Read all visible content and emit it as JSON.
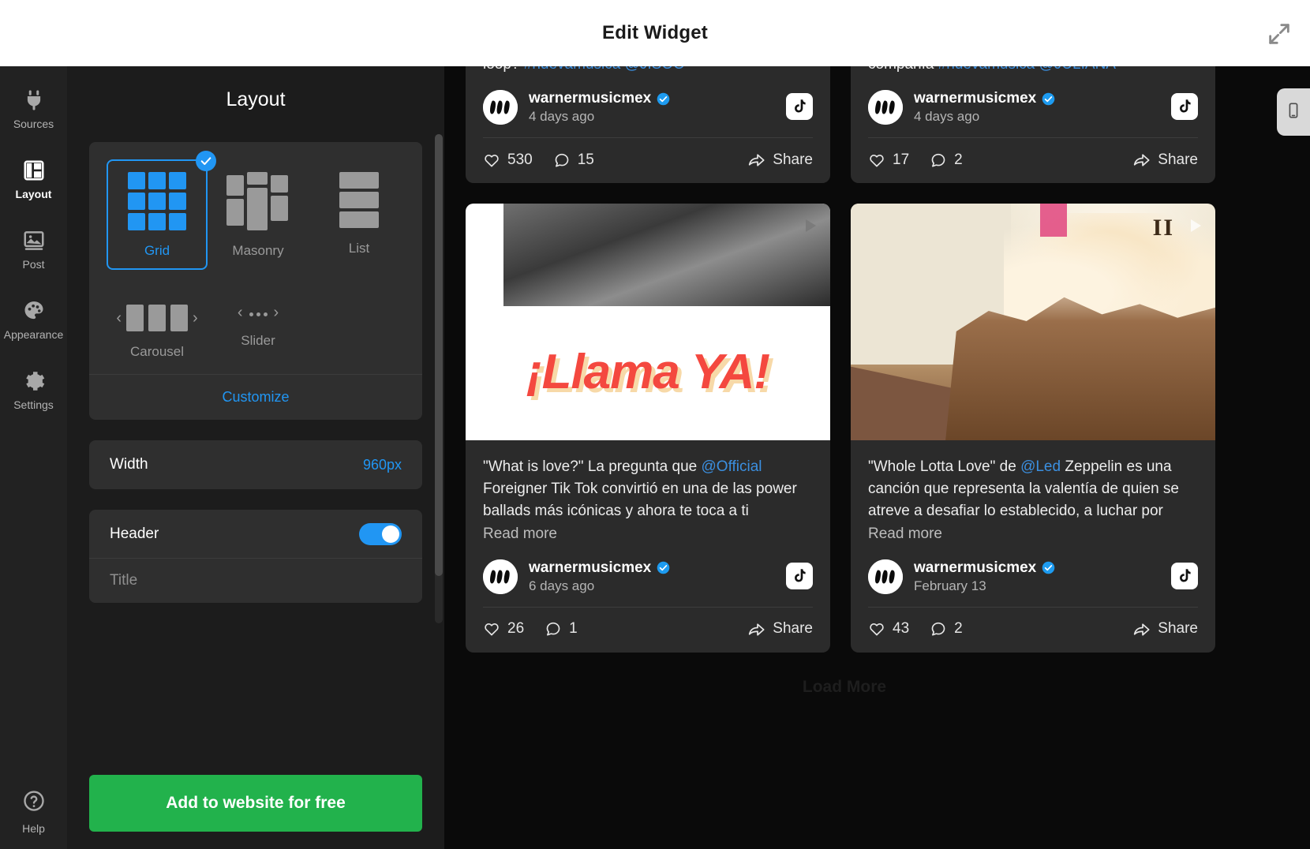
{
  "window": {
    "title": "Edit Widget",
    "expand_icon": "expand-arrows-icon"
  },
  "rail": {
    "items": [
      {
        "label": "Sources",
        "icon": "plug-icon",
        "active": false
      },
      {
        "label": "Layout",
        "icon": "layout-columns-icon",
        "active": true
      },
      {
        "label": "Post",
        "icon": "image-icon",
        "active": false
      },
      {
        "label": "Appearance",
        "icon": "palette-icon",
        "active": false
      },
      {
        "label": "Settings",
        "icon": "gear-icon",
        "active": false
      }
    ],
    "help": {
      "label": "Help",
      "icon": "question-circle-icon"
    }
  },
  "settings": {
    "title": "Layout",
    "layouts": [
      {
        "name": "Grid",
        "icon": "grid-thumb-icon",
        "selected": true
      },
      {
        "name": "Masonry",
        "icon": "masonry-thumb-icon",
        "selected": false
      },
      {
        "name": "List",
        "icon": "list-thumb-icon",
        "selected": false
      },
      {
        "name": "Carousel",
        "icon": "carousel-thumb-icon",
        "selected": false
      },
      {
        "name": "Slider",
        "icon": "slider-thumb-icon",
        "selected": false
      }
    ],
    "customize_label": "Customize",
    "width": {
      "label": "Width",
      "value": "960px"
    },
    "header": {
      "label": "Header",
      "enabled": true
    },
    "title_field": {
      "placeholder": "Title",
      "value": ""
    },
    "cta_label": "Add to website for free",
    "accent_color": "#2196f3",
    "cta_color": "#22b24c"
  },
  "preview": {
    "device_toggle_icon": "mobile-phone-icon",
    "load_more_label": "Load More",
    "posts": [
      {
        "id": "post-1",
        "text_before": "¿alguien más está escuchando 'earthquake' en loop? ",
        "hashtag": "#nuevamusica",
        "mention": "@JISOO",
        "read_more": "",
        "author": "warnermusicmex",
        "verified": true,
        "time": "4 days ago",
        "network_icon": "tiktok-icon",
        "likes": "530",
        "comments": "15",
        "share_label": "Share",
        "has_media": false
      },
      {
        "id": "post-2",
        "text_before": "mood: yo después de pasar San Valentín sin compañía ",
        "hashtag": "#nuevamusica",
        "mention": "@JULIANA",
        "read_more": "",
        "author": "warnermusicmex",
        "verified": true,
        "time": "4 days ago",
        "network_icon": "tiktok-icon",
        "likes": "17",
        "comments": "2",
        "share_label": "Share",
        "has_media": false
      },
      {
        "id": "post-3",
        "text_before": "\"What is love?\" La pregunta que ",
        "mention": "@Official",
        "text_after": " Foreigner Tik Tok convirtió en una de las power ballads más icónicas y ahora te toca a ti",
        "read_more": "Read more",
        "author": "warnermusicmex",
        "verified": true,
        "time": "6 days ago",
        "network_icon": "tiktok-icon",
        "likes": "26",
        "comments": "1",
        "share_label": "Share",
        "has_media": true,
        "media_caption": "¡Llama YA!",
        "media_kind": "video"
      },
      {
        "id": "post-4",
        "text_before": "\"Whole Lotta Love\" de ",
        "mention": "@Led",
        "text_after": " Zeppelin es una canción que representa la valentía de quien se atreve a desafiar lo establecido, a luchar por",
        "read_more": "Read more",
        "author": "warnermusicmex",
        "verified": true,
        "time": "February 13",
        "network_icon": "tiktok-icon",
        "likes": "43",
        "comments": "2",
        "share_label": "Share",
        "has_media": true,
        "media_caption": "II",
        "media_kind": "video"
      }
    ]
  }
}
